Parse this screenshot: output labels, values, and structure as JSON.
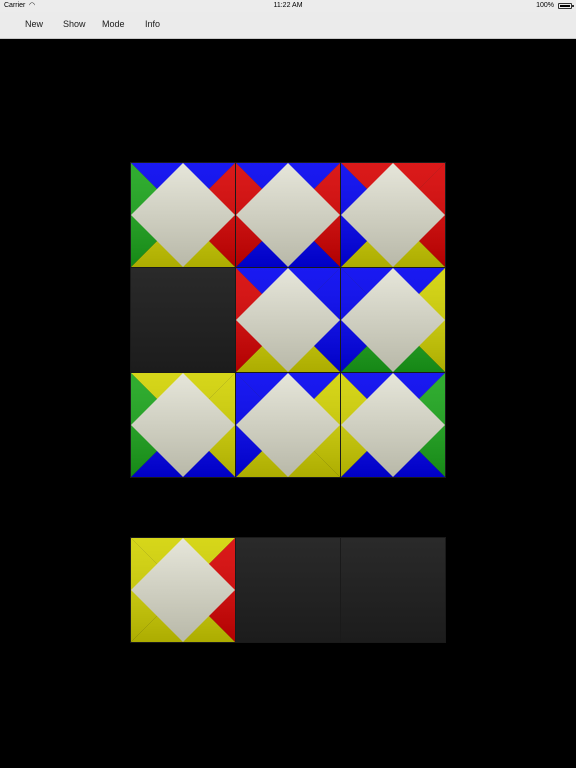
{
  "status_bar": {
    "carrier": "Carrier",
    "time": "11:22 AM",
    "battery": "100%",
    "battery_level": 1.0
  },
  "toolbar": {
    "new_label": "New",
    "show_label": "Show",
    "mode_label": "Mode",
    "info_label": "Info"
  },
  "colors": {
    "G": "#1aa51a",
    "B": "#0000f0",
    "R": "#d70000",
    "Y": "#d2d200",
    "center": "#dcdccc",
    "empty": "#222222"
  },
  "board": {
    "rows": 3,
    "cols": 3,
    "tiles": [
      {
        "top": "B",
        "right": "R",
        "bottom": "Y",
        "left": "G"
      },
      {
        "top": "B",
        "right": "R",
        "bottom": "B",
        "left": "R"
      },
      {
        "top": "R",
        "right": "R",
        "bottom": "Y",
        "left": "B"
      },
      null,
      {
        "top": "B",
        "right": "B",
        "bottom": "Y",
        "left": "R"
      },
      {
        "top": "B",
        "right": "Y",
        "bottom": "G",
        "left": "B"
      },
      {
        "top": "Y",
        "right": "Y",
        "bottom": "B",
        "left": "G"
      },
      {
        "top": "B",
        "right": "Y",
        "bottom": "Y",
        "left": "B"
      },
      {
        "top": "B",
        "right": "G",
        "bottom": "B",
        "left": "Y"
      }
    ]
  },
  "tray": {
    "cols": 3,
    "tiles": [
      {
        "top": "Y",
        "right": "R",
        "bottom": "Y",
        "left": "Y"
      },
      null,
      null
    ]
  }
}
